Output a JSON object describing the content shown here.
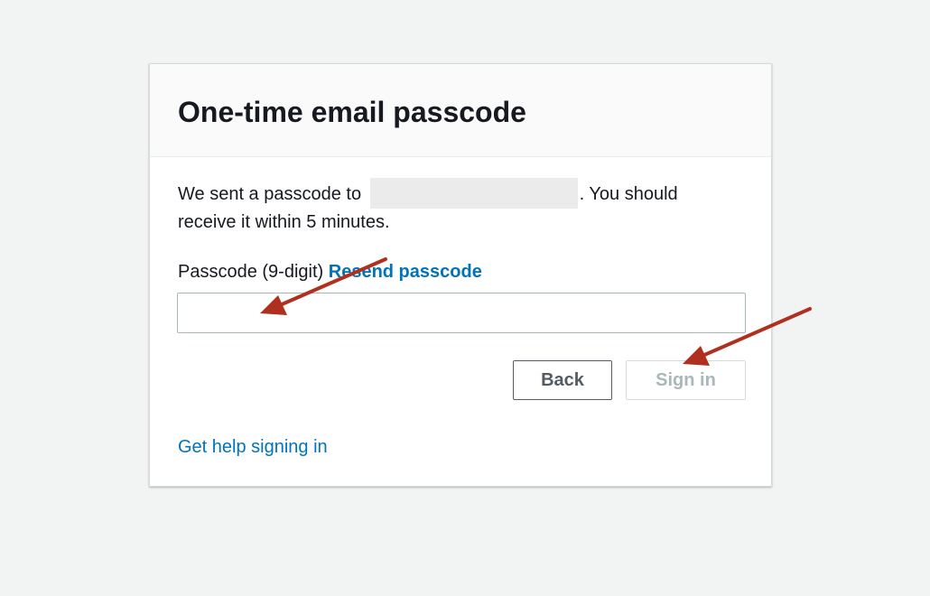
{
  "card": {
    "title": "One-time email passcode",
    "message_before": "We sent a passcode to",
    "message_after": ". You should receive it within 5 minutes.",
    "field_label": "Passcode (9-digit)",
    "resend_label": "Resend passcode",
    "passcode_value": "",
    "back_label": "Back",
    "signin_label": "Sign in",
    "help_label": "Get help signing in"
  },
  "colors": {
    "page_background": "#f2f3f3",
    "link": "#0073bb",
    "annotation_arrow": "#b0301f"
  }
}
